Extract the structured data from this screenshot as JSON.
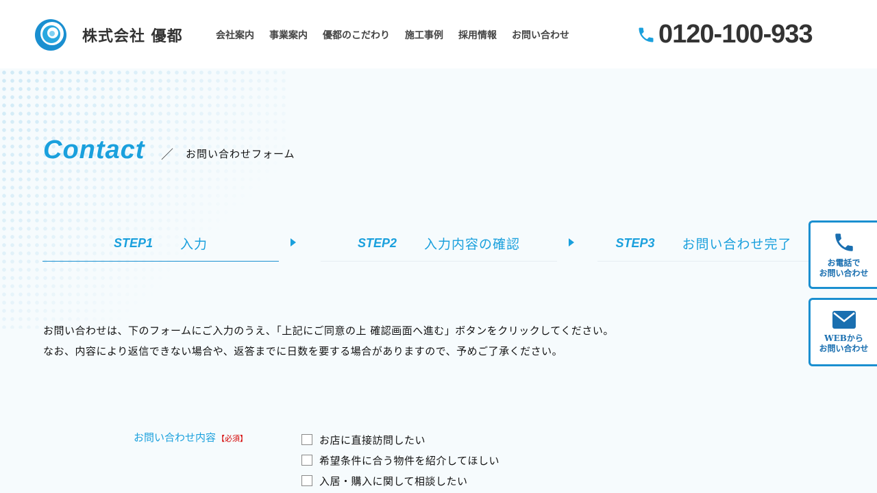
{
  "header": {
    "company_name": "株式会社 優都",
    "nav": [
      "会社案内",
      "事業案内",
      "優都のこだわり",
      "施工事例",
      "採用情報",
      "お問い合わせ"
    ],
    "tel_number": "0120-100-933",
    "tel_icon": "phone-icon",
    "logo_icon": "swirl-logo-icon"
  },
  "hero": {
    "title": "Contact",
    "separator": "／",
    "subtitle": "お問い合わせフォーム"
  },
  "steps": [
    {
      "no": "STEP1",
      "label": "入力",
      "active": true
    },
    {
      "no": "STEP2",
      "label": "入力内容の確認",
      "active": false
    },
    {
      "no": "STEP3",
      "label": "お問い合わせ完了",
      "active": false
    }
  ],
  "intro": {
    "line1": "お問い合わせは、下のフォームにご入力のうえ、「上記にご同意の上 確認画面へ進む」ボタンをクリックしてください。",
    "line2": "なお、内容により返信できない場合や、返答までに日数を要する場合がありますので、予めご了承ください。"
  },
  "form": {
    "inquiry_label": "お問い合わせ内容",
    "required": "【必須】",
    "options": [
      "お店に直接訪問したい",
      "希望条件に合う物件を紹介してほしい",
      "入居・購入に関して相談したい"
    ]
  },
  "side": {
    "phone_label_1": "お電話で",
    "phone_label_2": "お問い合わせ",
    "web_label_1": "WEBから",
    "web_label_2": "お問い合わせ"
  },
  "colors": {
    "accent": "#1aa0dd",
    "border": "#1a8fd0",
    "required": "#d40000"
  }
}
